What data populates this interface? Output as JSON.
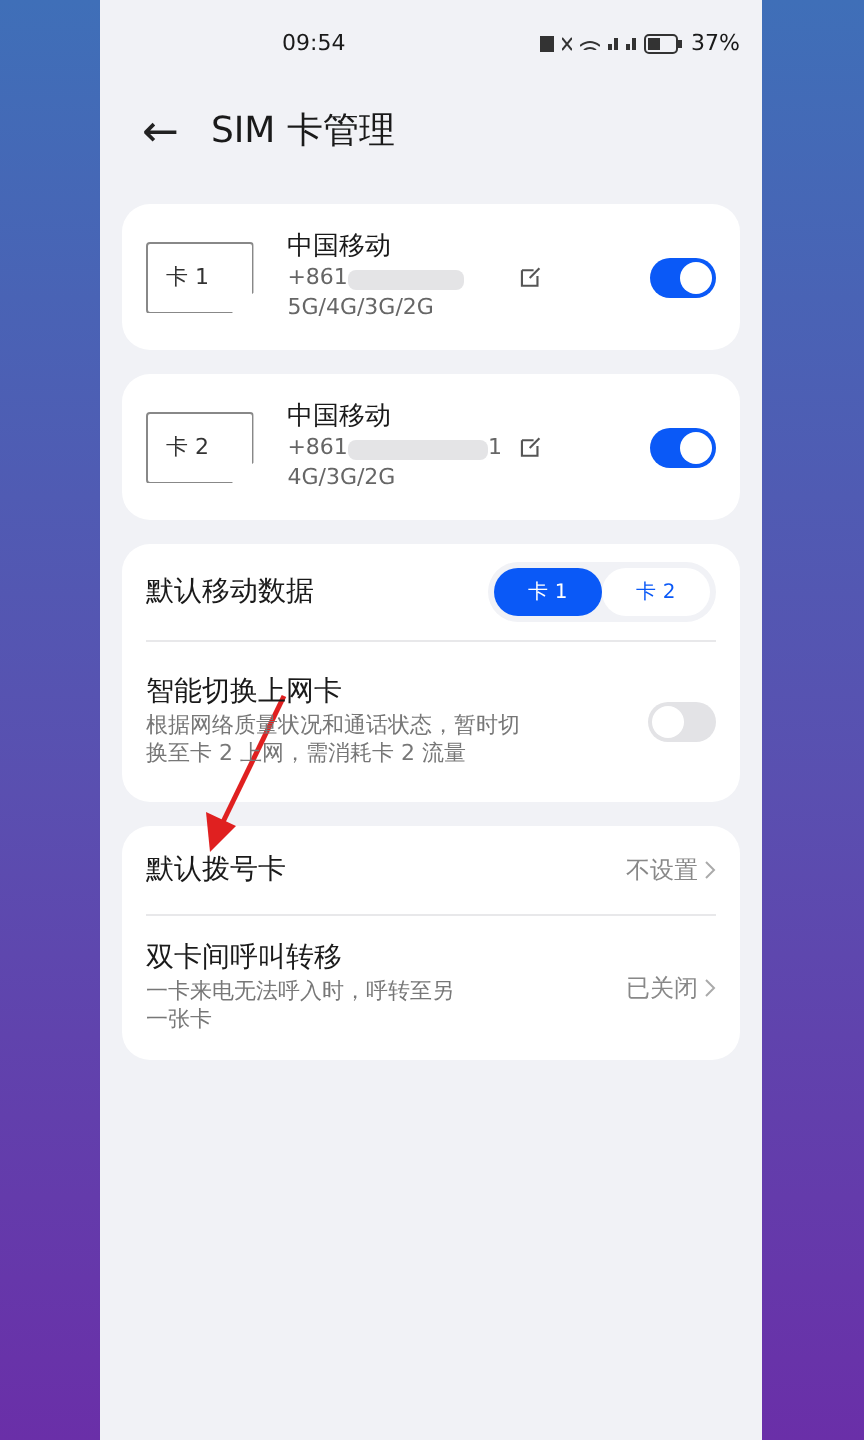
{
  "status_bar": {
    "time": "09:54",
    "battery": "37%"
  },
  "header": {
    "back": "←",
    "title": "SIM 卡管理"
  },
  "sim_cards": [
    {
      "slot_label": "卡 1",
      "carrier": "中国移动",
      "number_prefix": "+861",
      "networks": "5G/4G/3G/2G",
      "on": true
    },
    {
      "slot_label": "卡 2",
      "carrier": "中国移动",
      "number_prefix": "+861",
      "number_suffix": "1",
      "networks": "4G/3G/2G",
      "on": true
    }
  ],
  "mobile_data": {
    "label": "默认移动数据",
    "options": [
      {
        "label": "卡 1",
        "selected": true
      },
      {
        "label": "卡 2",
        "selected": false
      }
    ]
  },
  "smart_switch": {
    "title": "智能切换上网卡",
    "description": "根据网络质量状况和通话状态，暂时切换至卡 2 上网，需消耗卡 2 流量",
    "on": false
  },
  "call_settings": [
    {
      "title": "默认拨号卡",
      "value": "不设置"
    },
    {
      "title": "双卡间呼叫转移",
      "description": "一卡来电无法呼入时，呼转至另一张卡",
      "value": "已关闭"
    }
  ]
}
